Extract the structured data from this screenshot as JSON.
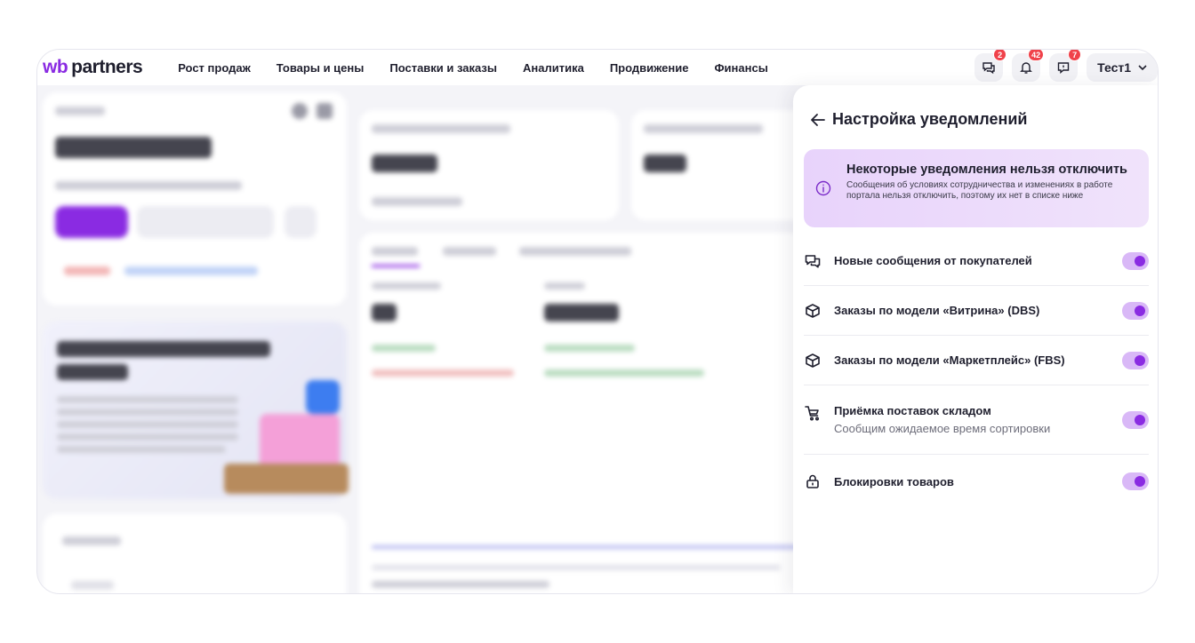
{
  "app": {
    "logo_wb": "wb",
    "logo_partners": "partners"
  },
  "nav": {
    "items": [
      "Рост продаж",
      "Товары и цены",
      "Поставки и заказы",
      "Аналитика",
      "Продвижение",
      "Финансы"
    ]
  },
  "header": {
    "chat_badge": "2",
    "notifications_badge": "42",
    "support_badge": "7",
    "user_name": "Тест1"
  },
  "panel": {
    "title": "Настройка уведомлений",
    "info_title": "Некоторые уведомления нельзя отключить",
    "info_text": "Сообщения об условиях сотрудничества и изменениях в работе портала нельзя отключить, поэтому их нет в списке ниже",
    "items": [
      {
        "label": "Новые сообщения от покупателей",
        "sub": "",
        "icon": "chat-icon",
        "enabled": true
      },
      {
        "label": "Заказы по модели «Витрина» (DBS)",
        "sub": "",
        "icon": "box-icon",
        "enabled": true
      },
      {
        "label": "Заказы по модели «Маркетплейс» (FBS)",
        "sub": "",
        "icon": "box-icon",
        "enabled": true
      },
      {
        "label": "Приёмка поставок складом",
        "sub": "Сообщим ожидаемое время сортировки",
        "icon": "cart-icon",
        "enabled": true
      },
      {
        "label": "Блокировки товаров",
        "sub": "",
        "icon": "lock-icon",
        "enabled": true
      }
    ]
  },
  "colors": {
    "accent": "#8a2be2",
    "toggle_track": "#d9b8f7",
    "badge": "#f0424a",
    "info_bg": "#ecdafb"
  }
}
